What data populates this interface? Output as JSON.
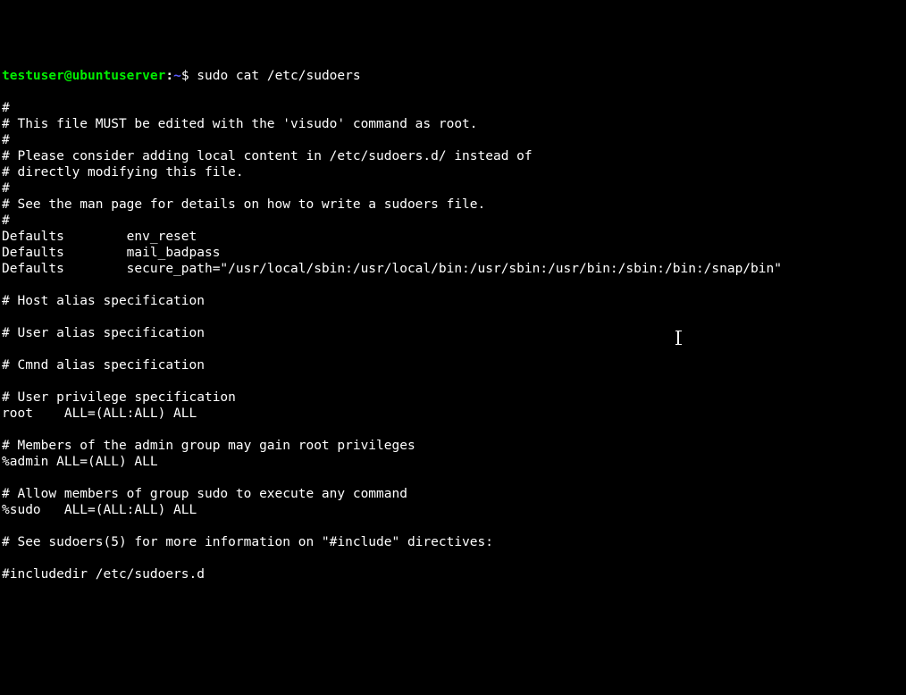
{
  "prompt": {
    "user": "testuser",
    "at": "@",
    "host": "ubuntuserver",
    "colon": ":",
    "path": "~",
    "dollar": "$ "
  },
  "command": "sudo cat /etc/sudoers",
  "output": [
    "#",
    "# This file MUST be edited with the 'visudo' command as root.",
    "#",
    "# Please consider adding local content in /etc/sudoers.d/ instead of",
    "# directly modifying this file.",
    "#",
    "# See the man page for details on how to write a sudoers file.",
    "#",
    "Defaults        env_reset",
    "Defaults        mail_badpass",
    "Defaults        secure_path=\"/usr/local/sbin:/usr/local/bin:/usr/sbin:/usr/bin:/sbin:/bin:/snap/bin\"",
    "",
    "# Host alias specification",
    "",
    "# User alias specification",
    "",
    "# Cmnd alias specification",
    "",
    "# User privilege specification",
    "root    ALL=(ALL:ALL) ALL",
    "",
    "# Members of the admin group may gain root privileges",
    "%admin ALL=(ALL) ALL",
    "",
    "# Allow members of group sudo to execute any command",
    "%sudo   ALL=(ALL:ALL) ALL",
    "",
    "# See sudoers(5) for more information on \"#include\" directives:",
    "",
    "#includedir /etc/sudoers.d"
  ]
}
